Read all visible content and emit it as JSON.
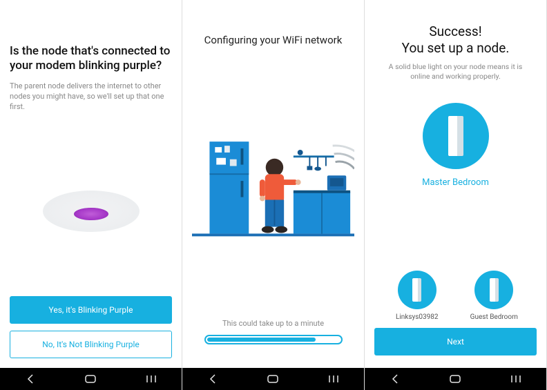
{
  "colors": {
    "accent": "#17b0e0",
    "purple": "#a638c8"
  },
  "screen1": {
    "title": "Is the node that's connected to your modem blinking purple?",
    "subtitle": "The parent node delivers the internet to other nodes you might have, so we'll set up that one first.",
    "btn_yes": "Yes, it's Blinking Purple",
    "btn_no": "No, It's Not Blinking Purple"
  },
  "screen2": {
    "title": "Configuring your WiFi network",
    "status": "This could take up to a minute",
    "progress_percent": 82
  },
  "screen3": {
    "title_line1": "Success!",
    "title_line2": "You set up a node.",
    "subtitle": "A solid blue light on your node means it is online and working properly.",
    "main_node_label": "Master Bedroom",
    "secondary_nodes": [
      {
        "label": "Linksys03982"
      },
      {
        "label": "Guest Bedroom"
      }
    ],
    "btn_next": "Next"
  }
}
